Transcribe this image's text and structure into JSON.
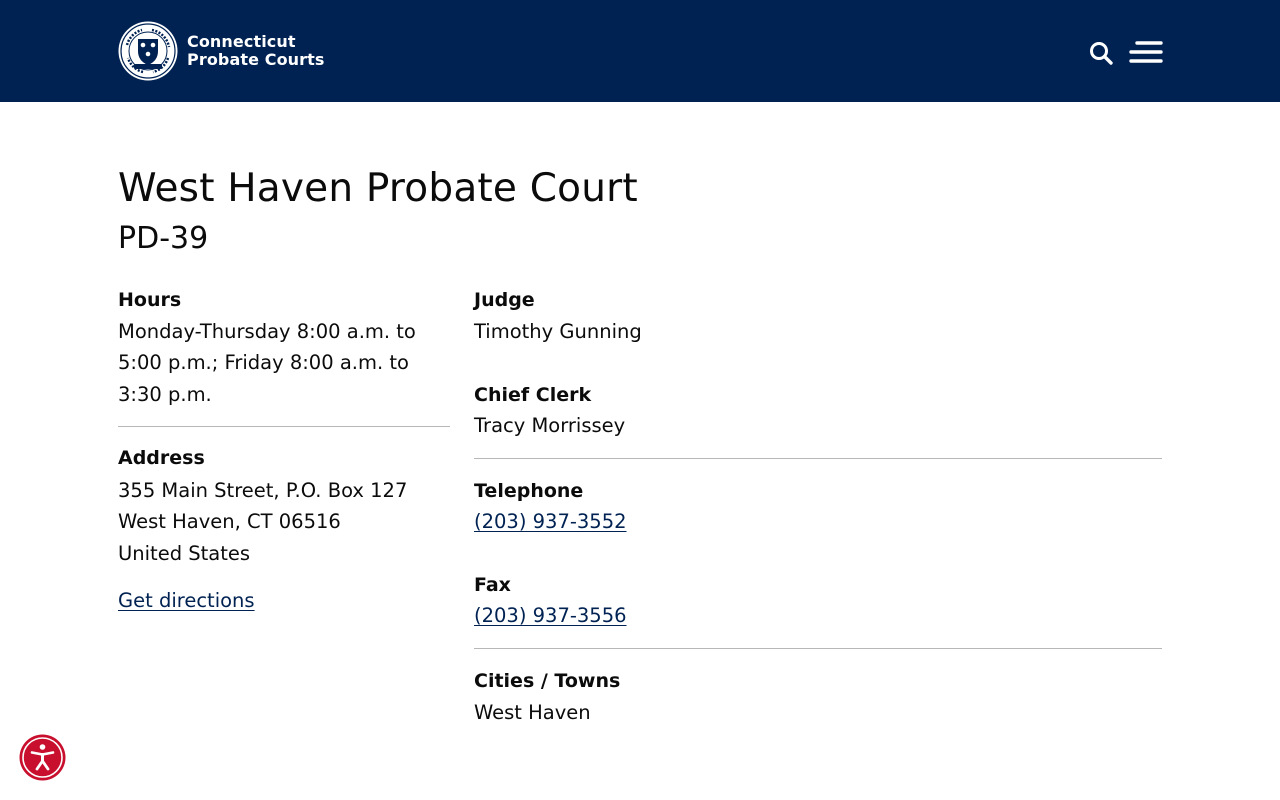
{
  "header": {
    "brand_line1": "Connecticut",
    "brand_line2": "Probate Courts",
    "bg_color": "#002252"
  },
  "page": {
    "title": "West Haven Probate Court",
    "subtitle": "PD-39"
  },
  "hours": {
    "label": "Hours",
    "lines": [
      "Monday-Thursday 8:00 a.m. to",
      "5:00 p.m.; Friday 8:00 a.m. to",
      "3:30 p.m."
    ]
  },
  "address": {
    "label": "Address",
    "line1": "355 Main Street, P.O. Box 127",
    "line2": "West Haven, CT 06516",
    "line3": "United States",
    "directions_link": "Get directions"
  },
  "judge": {
    "label": "Judge",
    "value": "Timothy Gunning"
  },
  "chief_clerk": {
    "label": "Chief Clerk",
    "value": "Tracy Morrissey"
  },
  "telephone": {
    "label": "Telephone",
    "value": "(203) 937-3552"
  },
  "fax": {
    "label": "Fax",
    "value": "(203) 937-3556"
  },
  "cities_towns": {
    "label": "Cities / Towns",
    "value": "West Haven"
  },
  "icons": {
    "logo": "connecticut-probate-courts-seal",
    "search": "search-icon",
    "menu": "hamburger-menu-icon",
    "accessibility": "accessibility-icon"
  },
  "colors": {
    "brand_navy": "#002252",
    "link": "#002252",
    "accessibility_button": "#c8102e"
  }
}
